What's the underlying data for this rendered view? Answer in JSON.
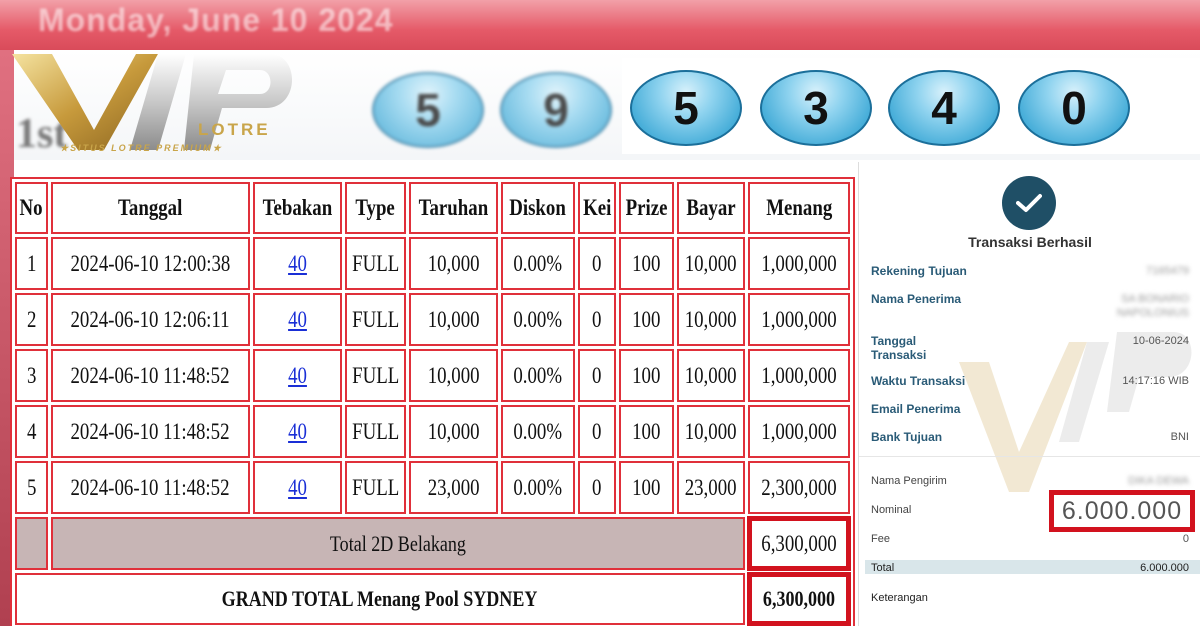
{
  "banner": {
    "date": "Monday, June 10 2024",
    "prize_label": "1st"
  },
  "logo": {
    "text": "VIP",
    "name": "LOTRE",
    "tagline": "★SITUS LOTRE PREMIUM★"
  },
  "result": {
    "digits": [
      "5",
      "9",
      "5",
      "3",
      "4",
      "0"
    ]
  },
  "table": {
    "headers": [
      "No",
      "Tanggal",
      "Tebakan",
      "Type",
      "Taruhan",
      "Diskon",
      "Kei",
      "Prize",
      "Bayar",
      "Menang"
    ],
    "rows": [
      {
        "no": "1",
        "tanggal": "2024-06-10 12:00:38",
        "tebakan": "40",
        "type": "FULL",
        "taruhan": "10,000",
        "diskon": "0.00%",
        "kei": "0",
        "prize": "100",
        "bayar": "10,000",
        "menang": "1,000,000"
      },
      {
        "no": "2",
        "tanggal": "2024-06-10 12:06:11",
        "tebakan": "40",
        "type": "FULL",
        "taruhan": "10,000",
        "diskon": "0.00%",
        "kei": "0",
        "prize": "100",
        "bayar": "10,000",
        "menang": "1,000,000"
      },
      {
        "no": "3",
        "tanggal": "2024-06-10 11:48:52",
        "tebakan": "40",
        "type": "FULL",
        "taruhan": "10,000",
        "diskon": "0.00%",
        "kei": "0",
        "prize": "100",
        "bayar": "10,000",
        "menang": "1,000,000"
      },
      {
        "no": "4",
        "tanggal": "2024-06-10 11:48:52",
        "tebakan": "40",
        "type": "FULL",
        "taruhan": "10,000",
        "diskon": "0.00%",
        "kei": "0",
        "prize": "100",
        "bayar": "10,000",
        "menang": "1,000,000"
      },
      {
        "no": "5",
        "tanggal": "2024-06-10 11:48:52",
        "tebakan": "40",
        "type": "FULL",
        "taruhan": "23,000",
        "diskon": "0.00%",
        "kei": "0",
        "prize": "100",
        "bayar": "23,000",
        "menang": "2,300,000"
      }
    ],
    "total_label": "Total 2D Belakang",
    "total_value": "6,300,000",
    "grand_label": "GRAND TOTAL  Menang Pool SYDNEY",
    "grand_value": "6,300,000"
  },
  "receipt": {
    "title": "Transaksi Berhasil",
    "rekening_label": "Rekening Tujuan",
    "rekening_value": "7165479",
    "penerima_label": "Nama Penerima",
    "penerima_value": "SA BONARIO",
    "penerima_value2": "NAPOLONIUS",
    "tanggal_label": "Tanggal",
    "tanggal_label2": "Transaksi",
    "tanggal_value": "10-06-2024",
    "waktu_label": "Waktu Transaksi",
    "waktu_value": "14:17:16 WIB",
    "email_label": "Email Penerima",
    "bank_label": "Bank Tujuan",
    "bank_value": "BNI",
    "pengirim_label": "Nama Pengirim",
    "pengirim_value": "DIKA DEWA",
    "nominal_label": "Nominal",
    "nominal_value": "6.000.000",
    "fee_label": "Fee",
    "fee_value": "0",
    "total_label": "Total",
    "total_value": "6.000.000",
    "keterangan_label": "Keterangan"
  },
  "colors": {
    "table_border": "#e0303a",
    "highlight": "#d2121e",
    "link": "#1a2fd6",
    "ball": "#3ea9d6",
    "check": "#1f4f66"
  }
}
